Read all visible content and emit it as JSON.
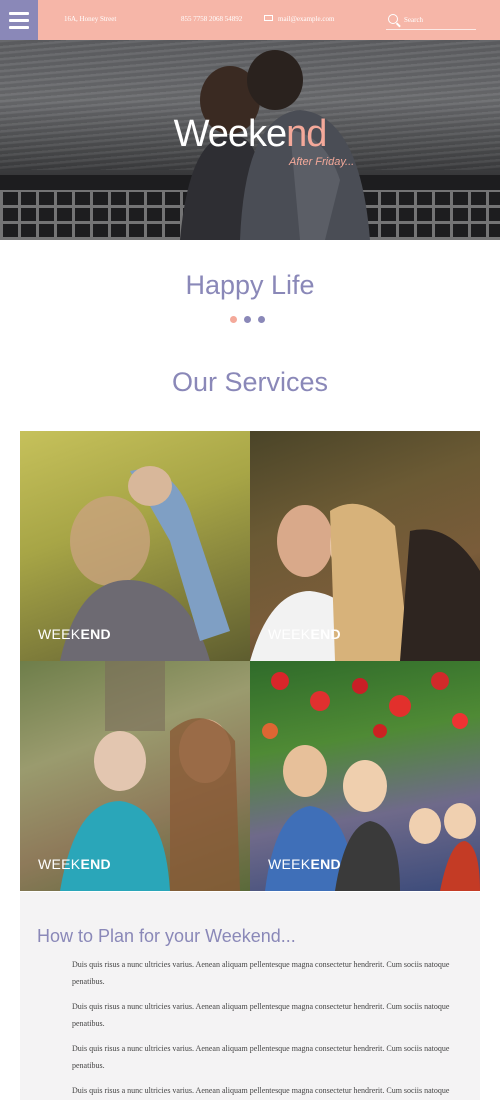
{
  "topbar": {
    "address": "16A, Honey Street",
    "phone": "855 7758 2068 54892",
    "email": "mail@example.com",
    "search_placeholder": "Search"
  },
  "hero": {
    "title_main": "Weeke",
    "title_accent": "nd",
    "subtitle": "After Friday..."
  },
  "happy_title": "Happy Life",
  "dots": {
    "colors": [
      "#f4a99a",
      "#8a88b8",
      "#8a88b8"
    ]
  },
  "services": {
    "title": "Our Services",
    "tiles": [
      {
        "label_a": "WEEK",
        "label_b": "END"
      },
      {
        "label_a": "WEEK",
        "label_b": "END"
      },
      {
        "label_a": "WEEK",
        "label_b": "END"
      },
      {
        "label_a": "WEEK",
        "label_b": "END"
      }
    ]
  },
  "plan": {
    "title": "How to Plan for your Weekend...",
    "paragraphs": [
      "Duis quis risus a nunc ultricies varius. Aenean aliquam pellentesque magna consectetur hendrerit. Cum sociis natoque penatibus.",
      "Duis quis risus a nunc ultricies varius. Aenean aliquam pellentesque magna consectetur hendrerit. Cum sociis natoque penatibus.",
      "Duis quis risus a nunc ultricies varius. Aenean aliquam pellentesque magna consectetur hendrerit. Cum sociis natoque penatibus.",
      "Duis quis risus a nunc ultricies varius. Aenean aliquam pellentesque magna consectetur hendrerit. Cum sociis natoque penatibus."
    ]
  },
  "colors": {
    "accent_pink": "#f6b6a8",
    "accent_purple": "#8a88b8"
  }
}
